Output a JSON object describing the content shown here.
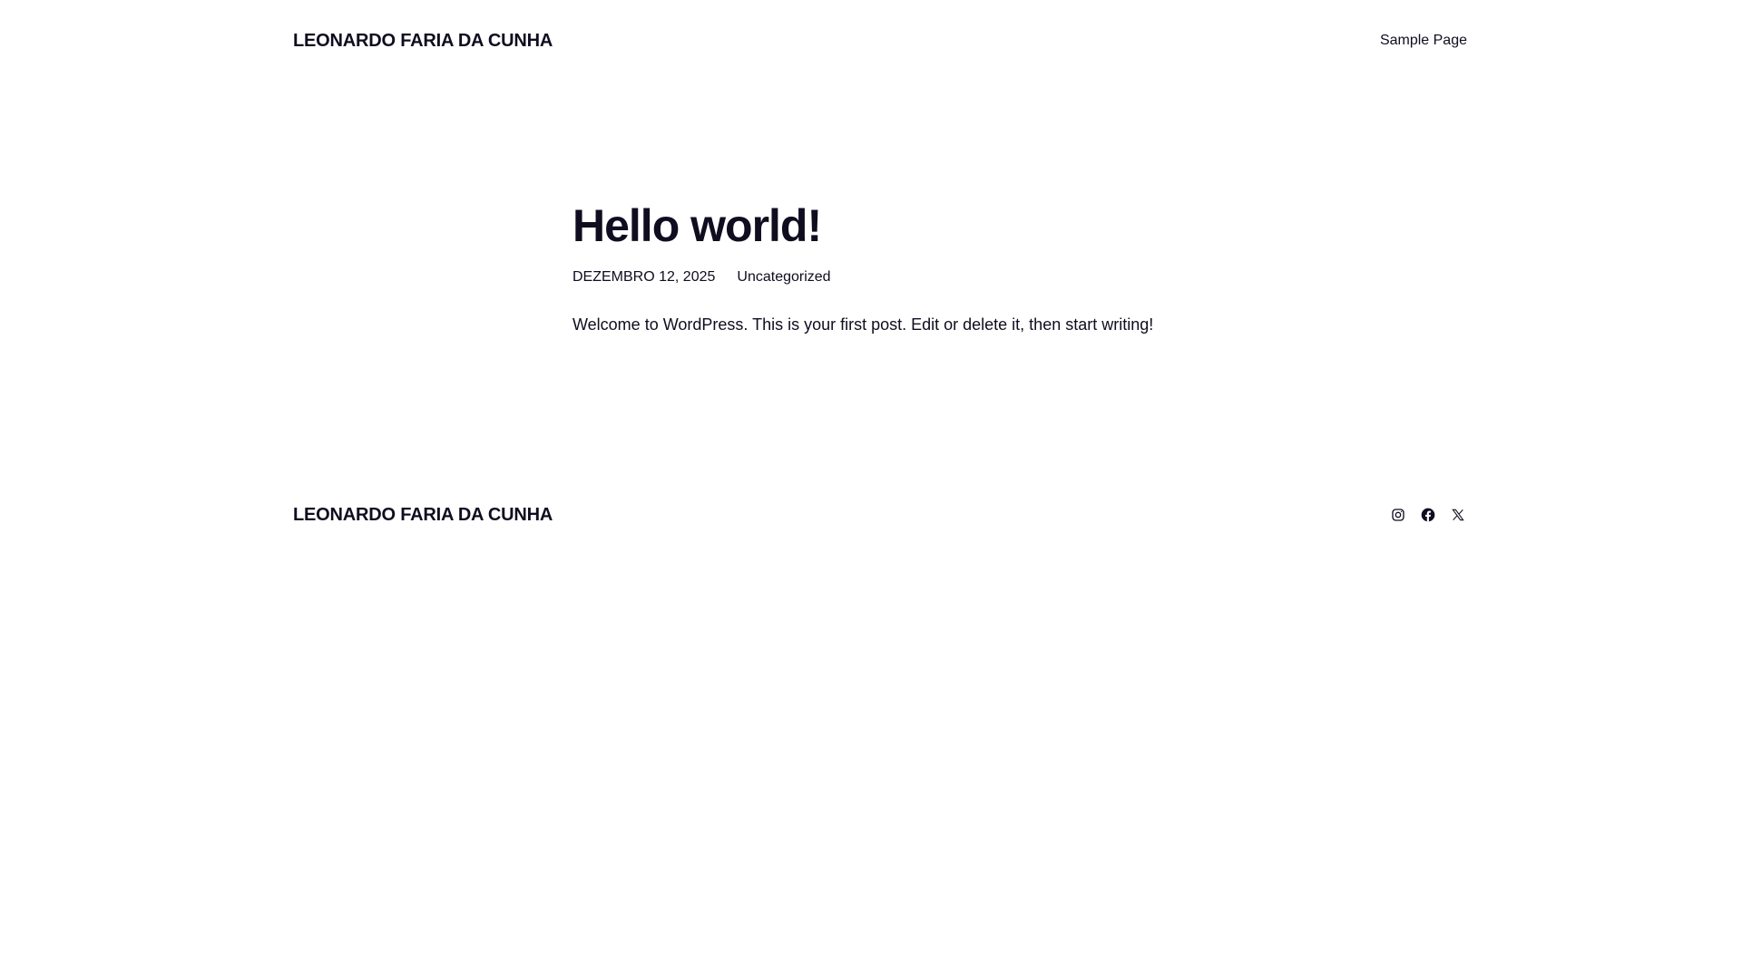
{
  "header": {
    "site_title": "LEONARDO FARIA DA CUNHA",
    "nav": [
      {
        "label": "Sample Page"
      }
    ]
  },
  "post": {
    "title": "Hello world!",
    "date": "DEZEMBRO 12, 2025",
    "category": "Uncategorized",
    "content": "Welcome to WordPress. This is your first post. Edit or delete it, then start writing!"
  },
  "footer": {
    "site_title": "LEONARDO FARIA DA CUNHA",
    "social": [
      {
        "icon": "instagram-icon"
      },
      {
        "icon": "facebook-icon"
      },
      {
        "icon": "x-icon"
      }
    ]
  },
  "colors": {
    "text": "#0f0d1f",
    "background": "#ffffff"
  }
}
